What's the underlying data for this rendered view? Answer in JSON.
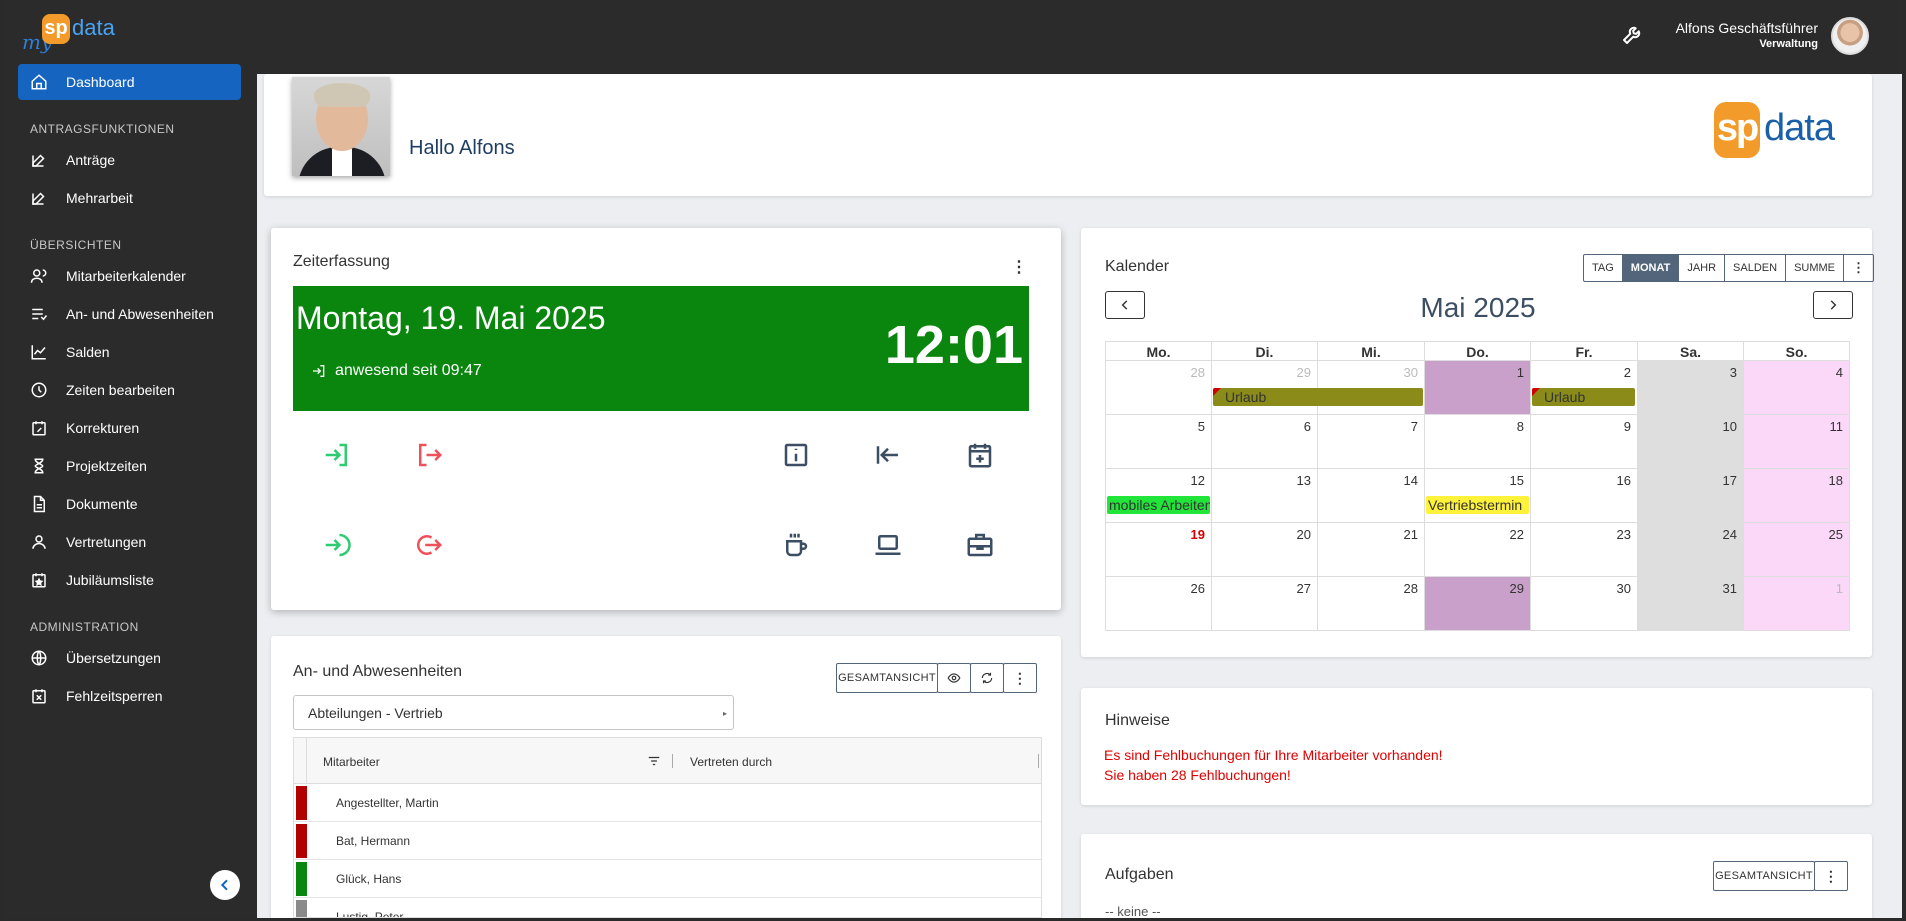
{
  "header": {
    "brand_my": "my",
    "brand_sp": "sp",
    "brand_data": "data",
    "user_name": "Alfons Geschäftsführer",
    "user_role": "Verwaltung"
  },
  "sidebar": {
    "dashboard": "Dashboard",
    "section_antrag": "ANTRAGSFUNKTIONEN",
    "antraege": "Anträge",
    "mehrarbeit": "Mehrarbeit",
    "section_uebersicht": "ÜBERSICHTEN",
    "mitarbeiterkalender": "Mitarbeiterkalender",
    "anwesenheiten": "An- und Abwesenheiten",
    "salden": "Salden",
    "zeiten": "Zeiten bearbeiten",
    "korrekturen": "Korrekturen",
    "projektzeiten": "Projektzeiten",
    "dokumente": "Dokumente",
    "vertretungen": "Vertretungen",
    "jubilaeum": "Jubiläumsliste",
    "section_admin": "ADMINISTRATION",
    "uebersetzungen": "Übersetzungen",
    "fehlzeitsperren": "Fehlzeitsperren"
  },
  "greeting": {
    "text": "Hallo Alfons",
    "logo_sp": "sp",
    "logo_data": "data"
  },
  "zeiterfassung": {
    "title": "Zeiterfassung",
    "date": "Montag, 19. Mai 2025",
    "time": "12:01",
    "status": "anwesend seit 09:47"
  },
  "kalender": {
    "title": "Kalender",
    "views": [
      "TAG",
      "MONAT",
      "JAHR",
      "SALDEN",
      "SUMME"
    ],
    "month": "Mai 2025",
    "weekdays": [
      "Mo.",
      "Di.",
      "Mi.",
      "Do.",
      "Fr.",
      "Sa.",
      "So."
    ],
    "weeks": [
      [
        "28",
        "29",
        "30",
        "1",
        "2",
        "3",
        "4"
      ],
      [
        "5",
        "6",
        "7",
        "8",
        "9",
        "10",
        "11"
      ],
      [
        "12",
        "13",
        "14",
        "15",
        "16",
        "17",
        "18"
      ],
      [
        "19",
        "20",
        "21",
        "22",
        "23",
        "24",
        "25"
      ],
      [
        "26",
        "27",
        "28",
        "29",
        "30",
        "31",
        "1"
      ]
    ],
    "events": {
      "urlaub1": "Urlaub",
      "urlaub2": "Urlaub",
      "mobil": "mobiles Arbeiten",
      "vertrieb": "Vertriebstermin"
    },
    "colors": {
      "urlaub": "#8b8b1a",
      "feiertag": "#c9a0c9",
      "wochenende": "#dedede",
      "sonntag": "#fbd7f8",
      "mobil": "#22e53a",
      "vertrieb": "#fff23a"
    }
  },
  "hinweise": {
    "title": "Hinweise",
    "line1": "Es sind Fehlbuchungen für Ihre Mitarbeiter vorhanden!",
    "line2": "Sie haben 28 Fehlbuchungen!"
  },
  "anwesenheiten": {
    "title": "An- und Abwesenheiten",
    "button": "GESAMTANSICHT",
    "dropdown": "Abteilungen - Vertrieb",
    "col_mitarbeiter": "Mitarbeiter",
    "col_vertreten": "Vertreten durch",
    "rows": [
      {
        "name": "Angestellter, Martin",
        "color": "#b00000"
      },
      {
        "name": "Bat, Hermann",
        "color": "#b00000"
      },
      {
        "name": "Glück, Hans",
        "color": "#0a860f"
      },
      {
        "name": "Lustig, Peter",
        "color": "#8a8a8a"
      }
    ]
  },
  "aufgaben": {
    "title": "Aufgaben",
    "button": "GESAMTANSICHT",
    "empty": "-- keine --"
  }
}
